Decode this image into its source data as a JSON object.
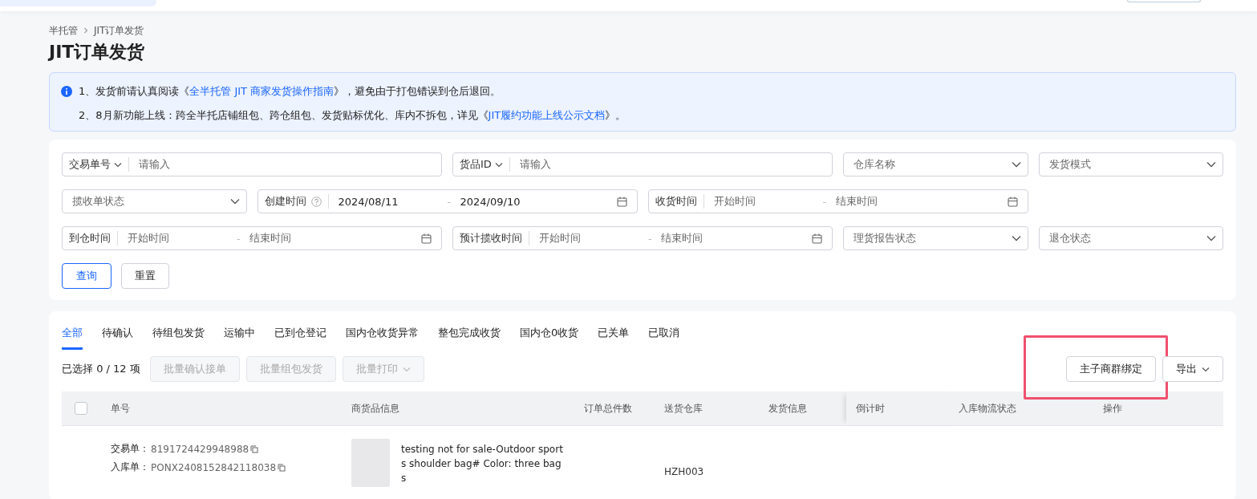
{
  "breadcrumb": [
    "半托管",
    "JIT订单发货"
  ],
  "title": "JIT订单发货",
  "notice": {
    "lines": [
      {
        "number": "1、",
        "before": "发货前请认真阅读《",
        "link": "全半托管 JIT 商家发货操作指南",
        "after": "》，避免由于打包错误到仓后退回。"
      },
      {
        "number": "2、",
        "before": "8月新功能上线：跨全半托店铺组包、跨仓组包、发货贴标优化、库内不拆包，详见《",
        "link": "JIT履约功能上线公示文档",
        "after": "》。"
      }
    ]
  },
  "filters": [
    {
      "kind": "select_input",
      "label": "交易单号",
      "placeholder": "请输入"
    },
    {
      "kind": "select_input",
      "label": "货品ID",
      "placeholder": "请输入"
    },
    {
      "kind": "select",
      "placeholder": "仓库名称"
    },
    {
      "kind": "select",
      "placeholder": "发货模式"
    },
    {
      "kind": "select",
      "placeholder": "揽收单状态"
    },
    {
      "kind": "date_range",
      "label": "创建时间",
      "help": true,
      "start": "2024/08/11",
      "separator": "-",
      "end": "2024/09/10"
    },
    {
      "kind": "date_range",
      "label": "收货时间",
      "help": false,
      "start_placeholder": "开始时间",
      "separator": "-",
      "end_placeholder": "结束时间"
    },
    {
      "kind": "break"
    },
    {
      "kind": "date_range",
      "label": "到仓时间",
      "help": false,
      "start_placeholder": "开始时间",
      "separator": "-",
      "end_placeholder": "结束时间"
    },
    {
      "kind": "date_range",
      "label": "预计揽收时间",
      "help": false,
      "start_placeholder": "开始时间",
      "separator": "-",
      "end_placeholder": "结束时间"
    },
    {
      "kind": "select",
      "placeholder": "理货报告状态"
    },
    {
      "kind": "select",
      "placeholder": "退仓状态"
    }
  ],
  "filter_buttons": [
    {
      "label": "查询",
      "primary": true
    },
    {
      "label": "重置",
      "primary": false
    }
  ],
  "tabs": [
    {
      "label": "全部",
      "selected": true
    },
    {
      "label": "待确认",
      "selected": false
    },
    {
      "label": "待组包发货",
      "selected": false
    },
    {
      "label": "运输中",
      "selected": false
    },
    {
      "label": "已到仓登记",
      "selected": false
    },
    {
      "label": "国内仓收货异常",
      "selected": false
    },
    {
      "label": "整包完成收货",
      "selected": false
    },
    {
      "label": "国内仓0收货",
      "selected": false
    },
    {
      "label": "已关单",
      "selected": false
    },
    {
      "label": "已取消",
      "selected": false
    }
  ],
  "selection_count": "已选择 0 / 12 项",
  "bulk_actions": [
    {
      "label": "批量确认接单",
      "disabled": true,
      "dropdown": false
    },
    {
      "label": "批量组包发货",
      "disabled": true,
      "dropdown": false
    },
    {
      "label": "批量打印",
      "disabled": true,
      "dropdown": true
    }
  ],
  "right_actions": [
    {
      "label": "主子商群绑定",
      "dropdown": false,
      "highlighted": true
    },
    {
      "label": "导出",
      "dropdown": true,
      "highlighted": false
    }
  ],
  "table": {
    "select_all_checked": false,
    "columns": [
      "单号",
      "商货品信息",
      "订单总件数",
      "送货仓库",
      "发货信息",
      "倒计时",
      "入库物流状态",
      "操作"
    ],
    "rows": [
      {
        "trade_label": "交易单：",
        "trade_no": "8191724429948988",
        "inbound_label": "入库单：",
        "inbound_no": "PONX2408152842118038",
        "product": "testing not for sale-Outdoor sports shoulder bag# Color: three bags",
        "warehouse": "HZH003"
      }
    ]
  }
}
